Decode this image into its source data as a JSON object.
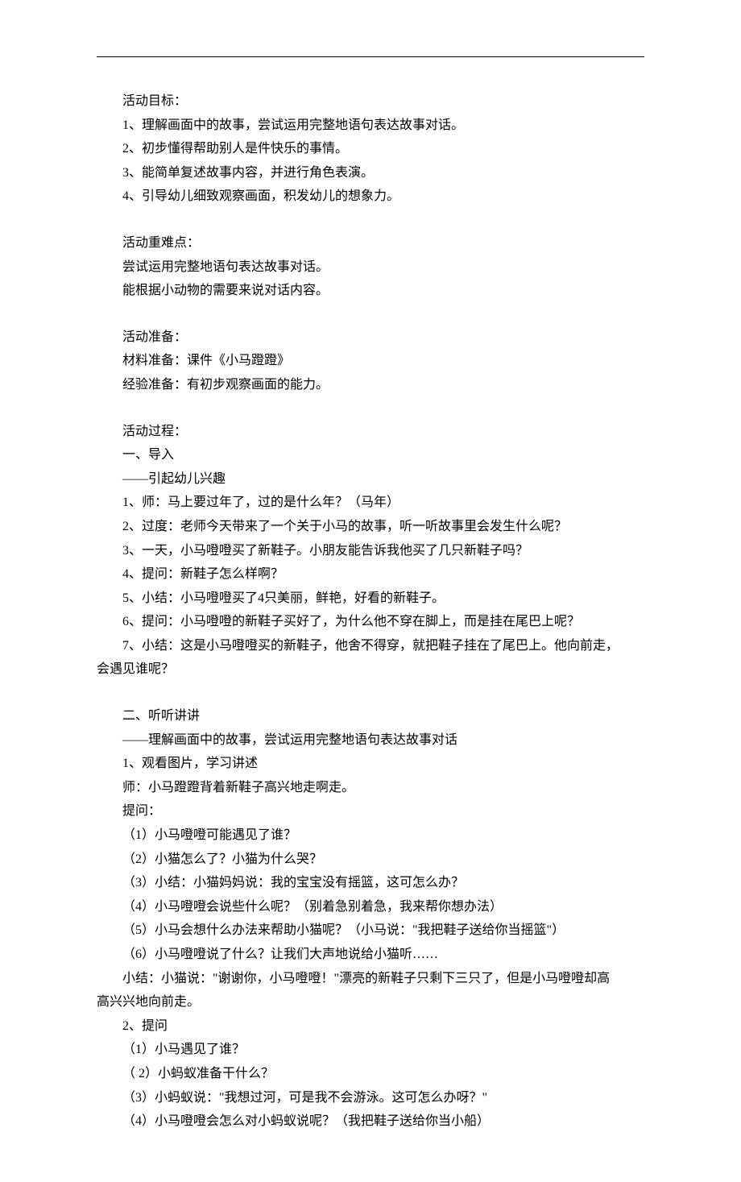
{
  "section_goals": {
    "title": "活动目标：",
    "items": [
      "1、理解画面中的故事，尝试运用完整地语句表达故事对话。",
      "2、初步懂得帮助别人是件快乐的事情。",
      "3、能简单复述故事内容，并进行角色表演。",
      "4、引导幼儿细致观察画面，积发幼儿的想象力。"
    ]
  },
  "section_difficulty": {
    "title": "活动重难点：",
    "lines": [
      "尝试运用完整地语句表达故事对话。",
      "能根据小动物的需要来说对话内容。"
    ]
  },
  "section_prepare": {
    "title": "活动准备：",
    "lines": [
      "材料准备：课件《小马蹬蹬》",
      "经验准备：有初步观察画面的能力。"
    ]
  },
  "section_process": {
    "title": "活动过程：",
    "part1": {
      "heading": "一、导入",
      "subheading": "——引起幼儿兴趣",
      "items": [
        "1、师：马上要过年了，过的是什么年？（马年）",
        "2、过度：老师今天带来了一个关于小马的故事，听一听故事里会发生什么呢？",
        "3、一天，小马噔噔买了新鞋子。小朋友能告诉我他买了几只新鞋子吗？",
        "4、提问：新鞋子怎么样啊？",
        "5、小结：小马噔噔买了4只美丽，鲜艳，好看的新鞋子。",
        "6、提问：小马噔噔的新鞋子买好了，为什么他不穿在脚上，而是挂在尾巴上呢？"
      ],
      "item7_line1": "7、小结：这是小马噔噔买的新鞋子，他舍不得穿，就把鞋子挂在了尾巴上。他向前走，",
      "item7_line2": "会遇见谁呢？"
    },
    "part2": {
      "heading": "二、听听讲讲",
      "subheading": "——理解画面中的故事，尝试运用完整地语句表达故事对话",
      "subpart1": {
        "title": "1、观看图片，学习讲述",
        "teacher": "师：小马蹬蹬背着新鞋子高兴地走啊走。",
        "questions_label": "提问：",
        "questions": [
          "（1）小马噔噔可能遇见了谁？",
          "（2）小猫怎么了？小猫为什么哭？",
          "（3）小结：小猫妈妈说：我的宝宝没有摇篮，这可怎么办？",
          "（4）小马噔噔会说些什么呢？（别着急别着急，我来帮你想办法）",
          "（5）小马会想什么办法来帮助小猫呢？（小马说：\"我把鞋子送给你当摇篮\"）",
          "（6）小马噔噔说了什么？让我们大声地说给小猫听……"
        ],
        "summary_line1": "小结：小猫说：\"谢谢你，小马噔噔！\"漂亮的新鞋子只剩下三只了，但是小马噔噔却高",
        "summary_line2": "高兴兴地向前走。"
      },
      "subpart2": {
        "title": "2、提问",
        "questions": [
          "（1）小马遇见了谁？",
          "（ 2）小蚂蚁准备干什么？",
          "（3）小蚂蚁说：\"我想过河，可是我不会游泳。这可怎么办呀？\"",
          "（4）小马噔噔会怎么对小蚂蚁说呢？（我把鞋子送给你当小船）"
        ]
      }
    }
  }
}
